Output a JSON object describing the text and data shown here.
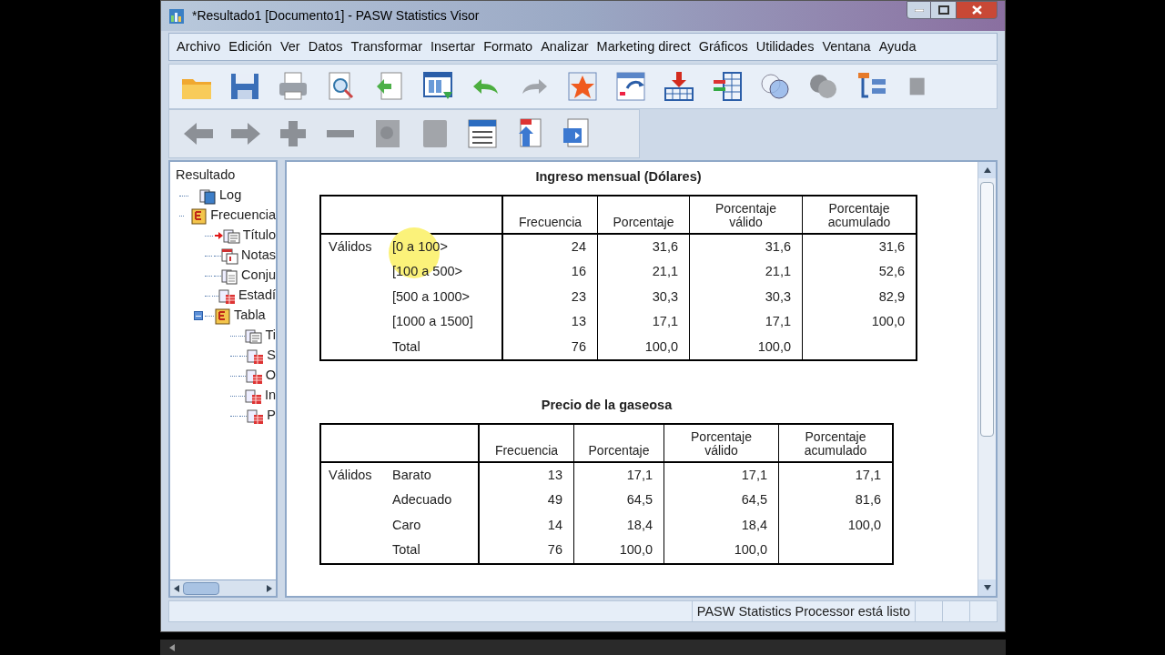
{
  "window": {
    "title": "*Resultado1 [Documento1] - PASW Statistics Visor"
  },
  "menu": [
    "Archivo",
    "Edición",
    "Ver",
    "Datos",
    "Transformar",
    "Insertar",
    "Formato",
    "Analizar",
    "Marketing direct",
    "Gráficos",
    "Utilidades",
    "Ventana",
    "Ayuda"
  ],
  "tree": {
    "label": "Resultado",
    "children": [
      {
        "label": "Log",
        "kind": "log",
        "current": false
      },
      {
        "label": "Frecuencia",
        "kind": "procedure",
        "current": false,
        "children": [
          {
            "label": "Título",
            "kind": "title",
            "current": true
          },
          {
            "label": "Notas",
            "kind": "notes",
            "current": false
          },
          {
            "label": "Conju",
            "kind": "text",
            "current": false
          },
          {
            "label": "Estadí",
            "kind": "table",
            "current": false
          },
          {
            "label": "Tabla",
            "kind": "procedure",
            "current": false,
            "expanded": true,
            "children": [
              {
                "label": "Ti",
                "kind": "title",
                "current": false
              },
              {
                "label": "S",
                "kind": "table",
                "current": false
              },
              {
                "label": "O",
                "kind": "table",
                "current": false
              },
              {
                "label": "In",
                "kind": "table",
                "current": false
              },
              {
                "label": "P",
                "kind": "table",
                "current": false
              }
            ]
          }
        ]
      }
    ]
  },
  "tables": [
    {
      "title": "Ingreso mensual (Dólares)",
      "columns": [
        "Frecuencia",
        "Porcentaje",
        "Porcentaje válido",
        "Porcentaje acumulado"
      ],
      "rows": [
        {
          "group": "Válidos",
          "label": "[0 a 100>",
          "cells": [
            "24",
            "31,6",
            "31,6",
            "31,6"
          ]
        },
        {
          "label": "[100 a 500>",
          "cells": [
            "16",
            "21,1",
            "21,1",
            "52,6"
          ]
        },
        {
          "label": "[500 a 1000>",
          "cells": [
            "23",
            "30,3",
            "30,3",
            "82,9"
          ]
        },
        {
          "label": "[1000 a 1500]",
          "cells": [
            "13",
            "17,1",
            "17,1",
            "100,0"
          ]
        },
        {
          "label": "Total",
          "cells": [
            "76",
            "100,0",
            "100,0"
          ]
        }
      ]
    },
    {
      "title": "Precio de la gaseosa",
      "columns": [
        "Frecuencia",
        "Porcentaje",
        "Porcentaje válido",
        "Porcentaje acumulado"
      ],
      "rows": [
        {
          "group": "Válidos",
          "label": "Barato",
          "cells": [
            "13",
            "17,1",
            "17,1",
            "17,1"
          ]
        },
        {
          "label": "Adecuado",
          "cells": [
            "49",
            "64,5",
            "64,5",
            "81,6"
          ]
        },
        {
          "label": "Caro",
          "cells": [
            "14",
            "18,4",
            "18,4",
            "100,0"
          ]
        },
        {
          "label": "Total",
          "cells": [
            "76",
            "100,0",
            "100,0"
          ]
        }
      ]
    }
  ],
  "status_bar": {
    "text": "PASW Statistics Processor está listo"
  }
}
